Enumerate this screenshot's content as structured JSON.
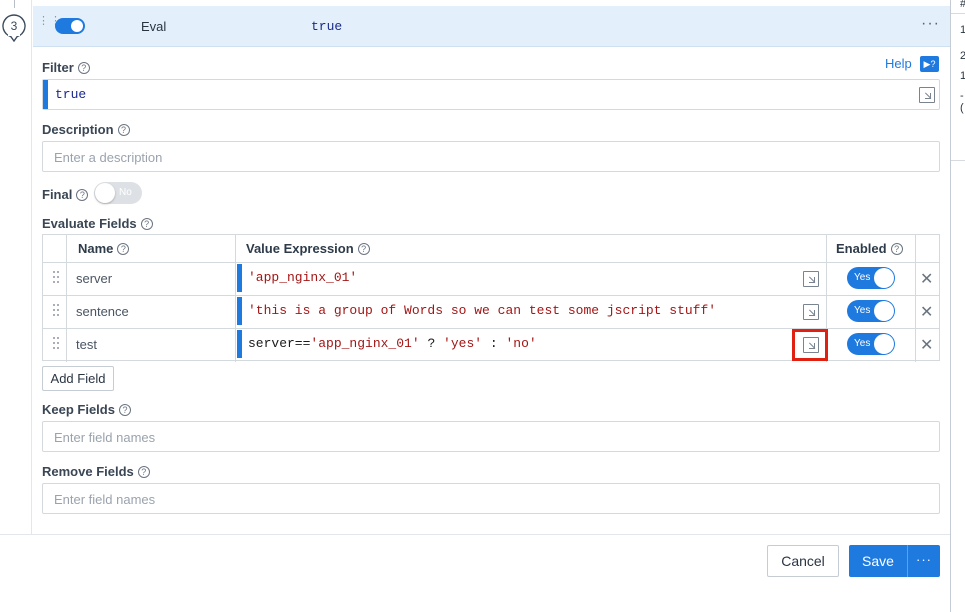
{
  "step": {
    "number": "3"
  },
  "function": {
    "name": "Eval",
    "description": "true",
    "more_label": "···"
  },
  "help": {
    "label": "Help"
  },
  "filter": {
    "label": "Filter",
    "value": "true"
  },
  "description": {
    "label": "Description",
    "placeholder": "Enter a description"
  },
  "final": {
    "label": "Final",
    "toggle_label": "No"
  },
  "evaluate_fields": {
    "label": "Evaluate Fields",
    "columns": {
      "name": "Name",
      "value": "Value Expression",
      "enabled": "Enabled"
    },
    "rows": [
      {
        "name": "server",
        "expr": [
          {
            "t": "'app_nginx_01'",
            "k": "str"
          }
        ],
        "enabled": "Yes"
      },
      {
        "name": "sentence",
        "expr": [
          {
            "t": "'this is a group of Words so we can test some jscript stuff'",
            "k": "str"
          }
        ],
        "enabled": "Yes"
      },
      {
        "name": "test",
        "expr": [
          {
            "t": "server==",
            "k": "plain"
          },
          {
            "t": "'app_nginx_01'",
            "k": "str"
          },
          {
            "t": " ? ",
            "k": "plain"
          },
          {
            "t": "'yes'",
            "k": "str"
          },
          {
            "t": " : ",
            "k": "plain"
          },
          {
            "t": "'no'",
            "k": "str"
          }
        ],
        "enabled": "Yes"
      }
    ],
    "add_label": "Add Field"
  },
  "keep_fields": {
    "label": "Keep Fields",
    "placeholder": "Enter field names"
  },
  "remove_fields": {
    "label": "Remove Fields",
    "placeholder": "Enter field names"
  },
  "footer": {
    "cancel_label": "Cancel",
    "save_label": "Save",
    "more_label": "···"
  },
  "right_panel": {
    "lines": [
      "#",
      "1",
      "2",
      "1",
      "-("
    ]
  },
  "colors": {
    "accent": "#1f7ae0",
    "string": "#a31515",
    "highlight": "#e02010"
  }
}
